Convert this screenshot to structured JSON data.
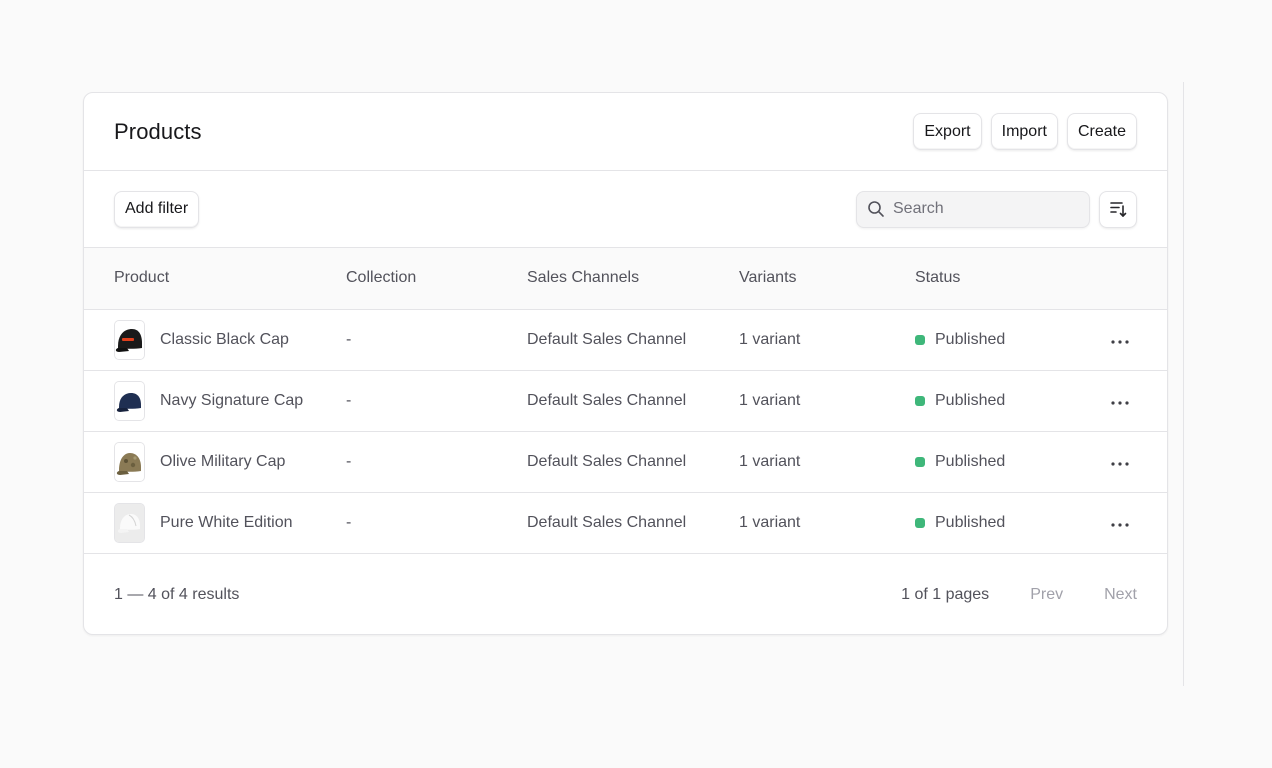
{
  "header": {
    "title": "Products",
    "actions": [
      {
        "label": "Export"
      },
      {
        "label": "Import"
      },
      {
        "label": "Create"
      }
    ]
  },
  "toolbar": {
    "add_filter_label": "Add filter",
    "search": {
      "placeholder": "Search",
      "value": ""
    },
    "sort_icon": "sort-descending-icon"
  },
  "table": {
    "columns": [
      "Product",
      "Collection",
      "Sales Channels",
      "Variants",
      "Status"
    ],
    "rows": [
      {
        "product": "Classic Black Cap",
        "collection": "-",
        "channels": "Default Sales Channel",
        "variants": "1 variant",
        "status": "Published"
      },
      {
        "product": "Navy Signature Cap",
        "collection": "-",
        "channels": "Default Sales Channel",
        "variants": "1 variant",
        "status": "Published"
      },
      {
        "product": "Olive Military Cap",
        "collection": "-",
        "channels": "Default Sales Channel",
        "variants": "1 variant",
        "status": "Published"
      },
      {
        "product": "Pure White Edition",
        "collection": "-",
        "channels": "Default Sales Channel",
        "variants": "1 variant",
        "status": "Published"
      }
    ]
  },
  "footer": {
    "results": "1 — 4 of 4 results",
    "pages": "1 of 1 pages",
    "prev_label": "Prev",
    "next_label": "Next"
  },
  "colors": {
    "status_published": "#3fb77a",
    "border": "#e4e4e7",
    "text_muted": "#52525b"
  }
}
